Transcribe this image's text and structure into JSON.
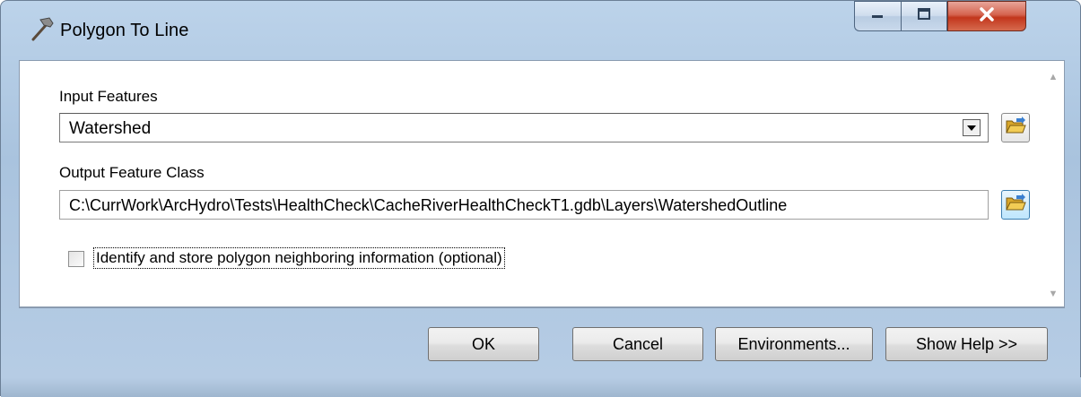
{
  "window": {
    "title": "Polygon To Line"
  },
  "form": {
    "input_features_label": "Input Features",
    "input_features_value": "Watershed",
    "output_feature_class_label": "Output Feature Class",
    "output_feature_class_value": "C:\\CurrWork\\ArcHydro\\Tests\\HealthCheck\\CacheRiverHealthCheckT1.gdb\\Layers\\WatershedOutline",
    "neighbor_checkbox_label": "Identify and store polygon neighboring information (optional)",
    "neighbor_checkbox_checked": false
  },
  "buttons": {
    "ok": "OK",
    "cancel": "Cancel",
    "environments": "Environments...",
    "show_help": "Show Help >>"
  },
  "icons": {
    "title": "hammer-icon",
    "browse": "folder-open-icon",
    "dropdown": "chevron-down-icon"
  }
}
